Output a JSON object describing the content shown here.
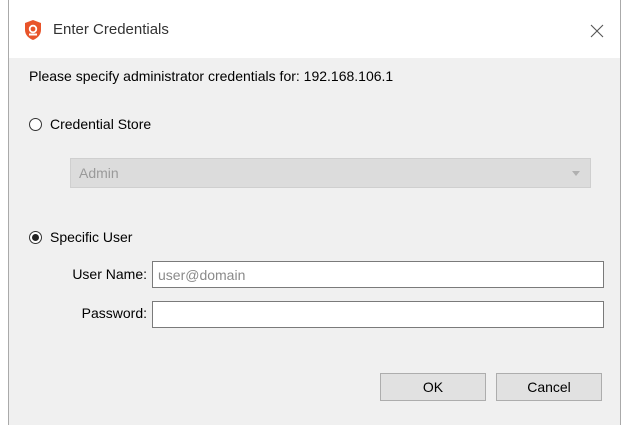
{
  "window": {
    "title": "Enter Credentials"
  },
  "prompt": "Please specify administrator credentials for: 192.168.106.1",
  "options": {
    "credential_store": {
      "label": "Credential Store",
      "checked": false,
      "selected_value": "Admin"
    },
    "specific_user": {
      "label": "Specific User",
      "checked": true
    }
  },
  "fields": {
    "username": {
      "label": "User Name:",
      "value": "",
      "placeholder": "user@domain"
    },
    "password": {
      "label": "Password:",
      "value": "",
      "placeholder": ""
    }
  },
  "buttons": {
    "ok": "OK",
    "cancel": "Cancel"
  },
  "icons": {
    "app": "shield-badge-icon",
    "close": "close-icon"
  },
  "colors": {
    "app_icon": "#e8542a",
    "disabled_select": "#dcdcdc"
  }
}
